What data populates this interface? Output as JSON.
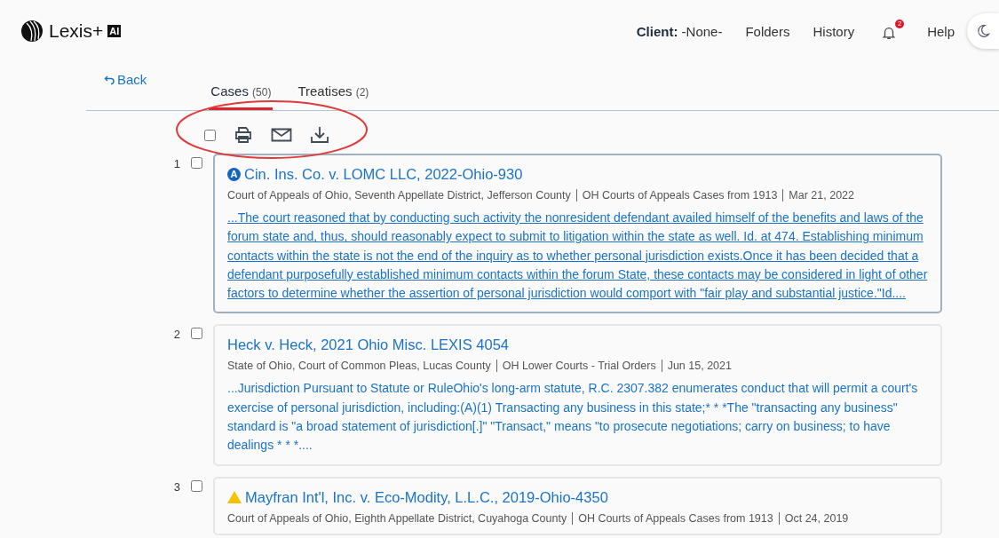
{
  "header": {
    "brand": "Lexis+",
    "brand_badge": "AI",
    "client_label": "Client:",
    "client_value": "-None-",
    "nav": [
      "Folders",
      "History"
    ],
    "notifications": "2",
    "help": "Help"
  },
  "back": "Back",
  "tabs": [
    {
      "label": "Cases",
      "count": "(50)",
      "selected": true
    },
    {
      "label": "Treatises",
      "count": "(2)",
      "selected": false
    }
  ],
  "toolbar": {
    "select_all_checked": false
  },
  "results": [
    {
      "number": "1",
      "checked": false,
      "kind": "positive",
      "signal_text": "A",
      "title": "Cin. Ins. Co. v. LOMC LLC, 2022-Ohio-930",
      "meta": [
        "Court of Appeals of Ohio, Seventh Appellate District, Jefferson County",
        "OH Courts of Appeals Cases from 1913",
        "Mar 21, 2022"
      ],
      "snippet": "...The court reasoned that by conducting such activity the nonresident defendant availed himself of the benefits and laws of the forum state and, thus, should reasonably expect to submit to litigation within the state as well. Id. at 474. Establishing minimum contacts within the state is not the end of the inquiry as to whether personal jurisdiction exists.Once it has been decided that a defendant purposefully established minimum contacts within the forum State, these contacts may be considered in light of other factors to determine whether the assertion of personal jurisdiction would comport with \"fair play and substantial justice.\"Id....",
      "hovered": true
    },
    {
      "number": "2",
      "checked": false,
      "kind": "plain",
      "title": "Heck v. Heck, 2021 Ohio Misc. LEXIS 4054",
      "meta": [
        "State of Ohio, Court of Common Pleas, Lucas County",
        "OH Lower Courts - Trial Orders",
        "Jun 15, 2021"
      ],
      "snippet": "...Jurisdiction Pursuant to Statute or RuleOhio's long-arm statute, R.C. 2307.382 enumerates conduct that will permit a court's exercise of personal jurisdiction, including:(A)(1) Transacting any business in this state;* * *The \"transacting any business\" standard is \"a broad statement of jurisdiction[.]\" \"Transact,\" means \"to prosecute negotiations; carry on business; to have dealings * * *....",
      "hovered": false
    },
    {
      "number": "3",
      "checked": false,
      "kind": "caution",
      "title": "Mayfran Int'l, Inc. v. Eco-Modity, L.L.C., 2019-Ohio-4350",
      "meta": [
        "Court of Appeals of Ohio, Eighth Appellate District, Cuyahoga County",
        "OH Courts of Appeals Cases from 1913",
        "Oct 24, 2019"
      ],
      "hovered": false
    }
  ]
}
